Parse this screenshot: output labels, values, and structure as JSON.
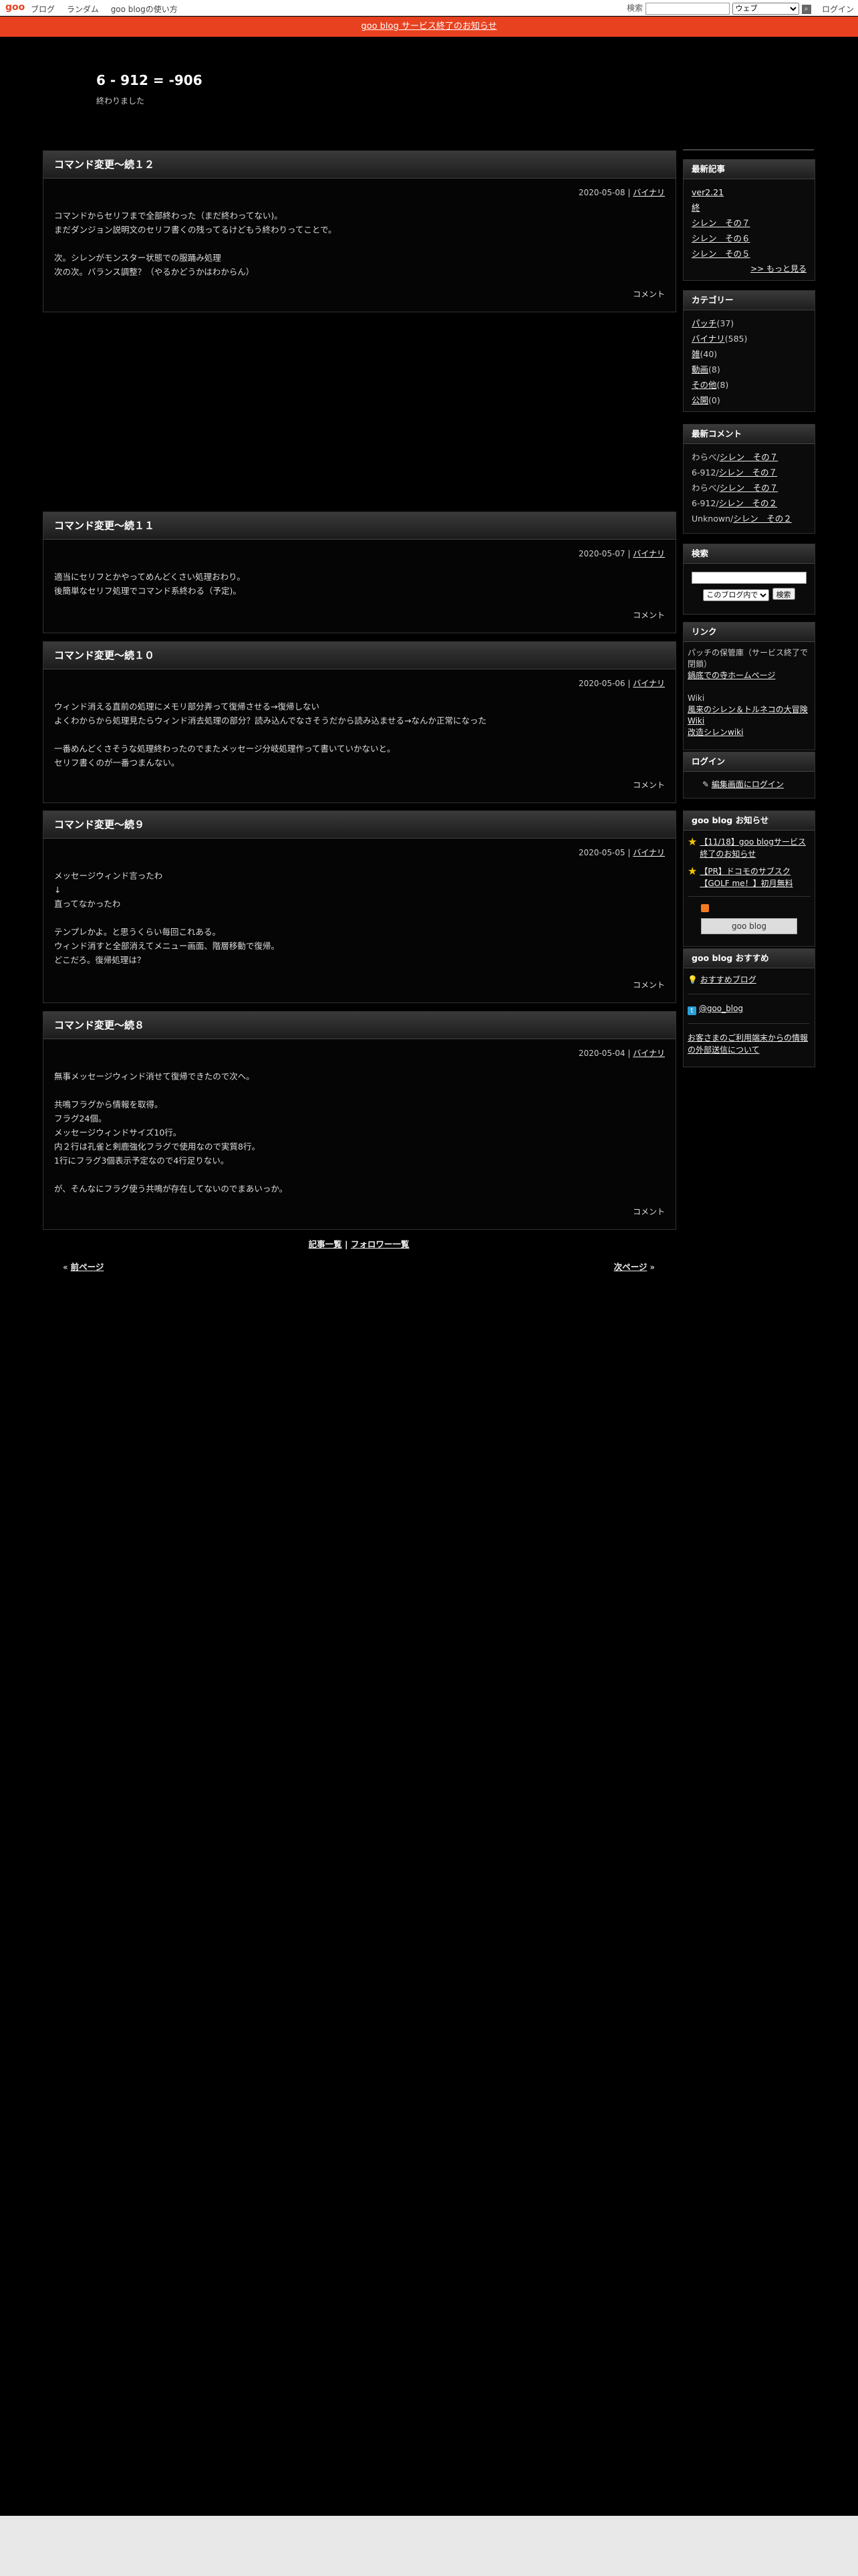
{
  "topbar": {
    "logo": "goo",
    "nav": [
      "ブログ",
      "ランダム",
      "goo blogの使い方"
    ],
    "search_label": "検索",
    "search_select": "ウェブ",
    "login": "ログイン"
  },
  "notice": "goo blog サービス終了のお知らせ",
  "blog": {
    "title": "6 - 912 = -906",
    "desc": "終わりました"
  },
  "entries": [
    {
      "title": "コマンド変更〜続１２",
      "date": "2020-05-08",
      "cat": "バイナリ",
      "body": "コマンドからセリフまで全部終わった（まだ終わってない)。\nまだダンジョン説明文のセリフ書くの残ってるけどもう終わりってことで。\n\n次。シレンがモンスター状態での服踊み処理\n次の次。バランス調整？（やるかどうかはわからん）",
      "foot": "コメント"
    },
    {
      "title": "コマンド変更〜続１１",
      "date": "2020-05-07",
      "cat": "バイナリ",
      "body": "適当にセリフとかやってめんどくさい処理おわり。\n後簡単なセリフ処理でコマンド系終わる（予定)。",
      "foot": "コメント"
    },
    {
      "title": "コマンド変更〜続１０",
      "date": "2020-05-06",
      "cat": "バイナリ",
      "body": "ウィンド消える直前の処理にメモリ部分弄って復帰させる→復帰しない\nよくわからから処理見たらウィンド消去処理の部分？読み込んでなさそうだから読み込ませる→なんか正常になった\n\n一番めんどくさそうな処理終わったのでまたメッセージ分岐処理作って書いていかないと。\nセリフ書くのが一番つまんない。",
      "foot": "コメント"
    },
    {
      "title": "コマンド変更〜続９",
      "date": "2020-05-05",
      "cat": "バイナリ",
      "body": "メッセージウィンド言ったわ\n↓\n直ってなかったわ\n\nテンプレかよ。と思うくらい毎回これある。\nウィンド消すと全部消えてメニュー画面、階層移動で復帰。\nどこだろ。復帰処理は？",
      "foot": "コメント"
    },
    {
      "title": "コマンド変更〜続８",
      "date": "2020-05-04",
      "cat": "バイナリ",
      "body": "無事メッセージウィンド消せて復帰できたので次へ。\n\n共鳴フラグから情報を取得。\nフラグ24個。\nメッセージウィンドサイズ10行。\n内２行は孔雀と剣鹿強化フラグで使用なので実質8行。\n1行にフラグ3個表示予定なので4行足りない。\n\nが、そんなにフラグ使う共鳴が存在してないのでまあいっか。",
      "foot": "コメント"
    }
  ],
  "bottom_links": {
    "list": "記事一覧",
    "sep": " | ",
    "follow": "フォロワー一覧",
    "prev": "前ページ",
    "next": "次ページ",
    "lq": "«",
    "rq": "»"
  },
  "sidebar": {
    "recent_title": "最新記事",
    "recent": [
      "ver2.21",
      "終",
      "シレン　その７",
      "シレン　その６",
      "シレン　その５"
    ],
    "more": ">> もっと見る",
    "cat_title": "カテゴリー",
    "cats": [
      {
        "name": "パッチ",
        "count": "(37)"
      },
      {
        "name": "バイナリ",
        "count": "(585)"
      },
      {
        "name": "雑",
        "count": "(40)"
      },
      {
        "name": "動画",
        "count": "(8)"
      },
      {
        "name": "その他",
        "count": "(8)"
      },
      {
        "name": "公開",
        "count": "(0)"
      }
    ],
    "comment_title": "最新コメント",
    "comments": [
      {
        "who": "わらべ/",
        "post": "シレン　その７"
      },
      {
        "who": "6-912/",
        "post": "シレン　その７"
      },
      {
        "who": "わらべ/",
        "post": "シレン　その７"
      },
      {
        "who": "6-912/",
        "post": "シレン　その２"
      },
      {
        "who": "Unknown/",
        "post": "シレン　その２"
      }
    ],
    "search_title": "検索",
    "search_select": "このブログ内で",
    "search_btn": "検索",
    "link_title": "リンク",
    "link_text1": "パッチの保管庫（サービス終了で閉鎖）",
    "link_text1b": "鍋底での寺ホームページ",
    "wiki_label": "Wiki",
    "wiki1": "風来のシレン＆トルネコの大冒険 Wiki",
    "wiki2": "改造シレンwiki",
    "login_title": "ログイン",
    "login_link": "編集画面にログイン",
    "notice_title": "goo blog お知らせ",
    "notice1": "【11/18】goo blogサービス終了のお知らせ",
    "notice2": "【PR】ドコモのサブスク【GOLF me！】初月無料",
    "goo_btn": "goo blog",
    "rec_title": "goo blog おすすめ",
    "rec1": "おすすめブログ",
    "twitter": "@goo_blog",
    "ext": "お客さまのご利用端末からの情報の外部送信について"
  }
}
